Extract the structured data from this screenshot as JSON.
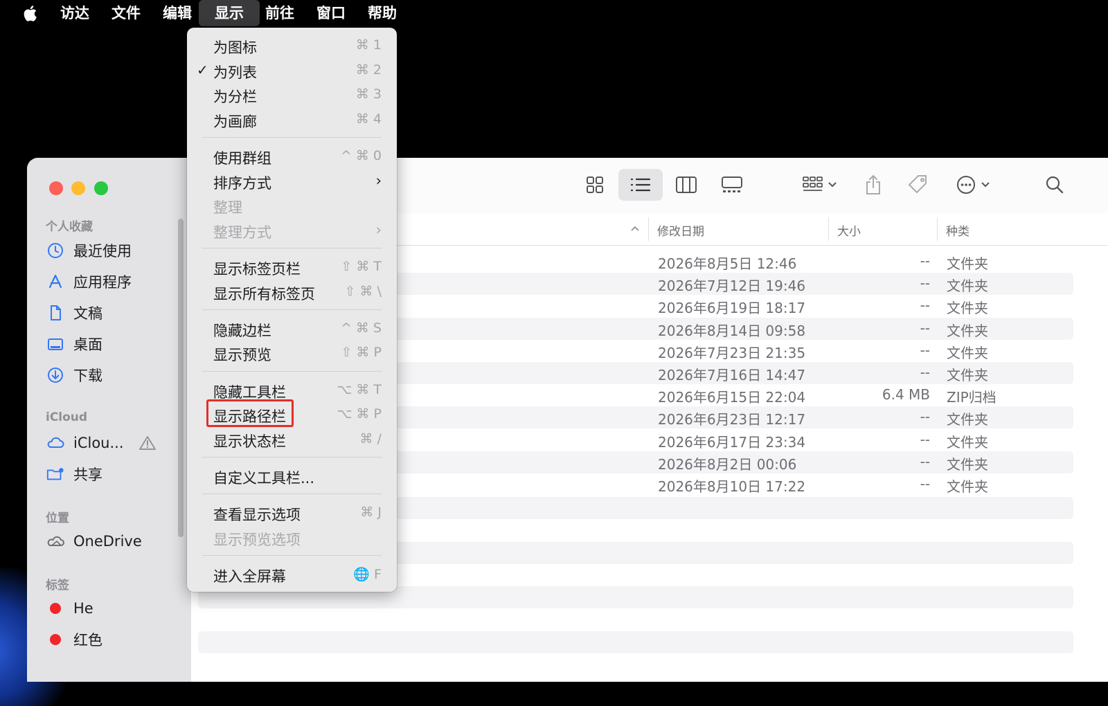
{
  "menubar": {
    "items": [
      "访达",
      "文件",
      "编辑",
      "显示",
      "前往",
      "窗口",
      "帮助"
    ],
    "active": "显示"
  },
  "view_menu": {
    "items": [
      {
        "label": "为图标",
        "shortcut": "⌘ 1",
        "checked": false,
        "disabled": false
      },
      {
        "label": "为列表",
        "shortcut": "⌘ 2",
        "checked": true,
        "disabled": false
      },
      {
        "label": "为分栏",
        "shortcut": "⌘ 3",
        "checked": false,
        "disabled": false
      },
      {
        "label": "为画廊",
        "shortcut": "⌘ 4",
        "checked": false,
        "disabled": false
      },
      {
        "label": "使用群组",
        "shortcut": "^ ⌘ 0",
        "checked": false,
        "disabled": false
      },
      {
        "label": "排序方式",
        "shortcut": "",
        "submenu": true,
        "disabled": false
      },
      {
        "label": "整理",
        "shortcut": "",
        "disabled": true
      },
      {
        "label": "整理方式",
        "shortcut": "",
        "submenu": true,
        "disabled": true
      },
      {
        "label": "显示标签页栏",
        "shortcut": "⇧ ⌘ T",
        "disabled": false
      },
      {
        "label": "显示所有标签页",
        "shortcut": "⇧ ⌘ \\",
        "disabled": false
      },
      {
        "label": "隐藏边栏",
        "shortcut": "^ ⌘ S",
        "disabled": false
      },
      {
        "label": "显示预览",
        "shortcut": "⇧ ⌘ P",
        "disabled": false
      },
      {
        "label": "隐藏工具栏",
        "shortcut": "⌥ ⌘ T",
        "disabled": false
      },
      {
        "label": "显示路径栏",
        "shortcut": "⌥ ⌘ P",
        "disabled": false,
        "highlighted": true
      },
      {
        "label": "显示状态栏",
        "shortcut": "⌘ /",
        "disabled": false
      },
      {
        "label": "自定义工具栏...",
        "shortcut": "",
        "disabled": false
      },
      {
        "label": "查看显示选项",
        "shortcut": "⌘ J",
        "disabled": false
      },
      {
        "label": "显示预览选项",
        "shortcut": "",
        "disabled": true
      },
      {
        "label": "进入全屏幕",
        "shortcut": "🌐 F",
        "disabled": false
      }
    ]
  },
  "sidebar": {
    "favorites_header": "个人收藏",
    "favorites": [
      {
        "label": "最近使用",
        "icon": "clock-icon"
      },
      {
        "label": "应用程序",
        "icon": "applications-icon"
      },
      {
        "label": "文稿",
        "icon": "document-icon"
      },
      {
        "label": "桌面",
        "icon": "desktop-icon"
      },
      {
        "label": "下载",
        "icon": "download-icon"
      }
    ],
    "icloud_header": "iCloud",
    "icloud": [
      {
        "label": "iClou...",
        "icon": "cloud-icon"
      },
      {
        "label": "共享",
        "icon": "shared-folder-icon"
      }
    ],
    "locations_header": "位置",
    "locations": [
      {
        "label": "OneDrive",
        "icon": "onedrive-cloud-icon"
      }
    ],
    "tags_header": "标签",
    "tags": [
      {
        "label": "He",
        "color": "#f0262a"
      },
      {
        "label": "红色",
        "color": "#f0262a"
      }
    ]
  },
  "columns": {
    "date": "修改日期",
    "size": "大小",
    "kind": "种类"
  },
  "files": [
    {
      "date": "2026年8月5日 12:46",
      "size": "--",
      "kind": "文件夹"
    },
    {
      "date": "2026年7月12日 19:46",
      "size": "--",
      "kind": "文件夹"
    },
    {
      "date": "2026年6月19日 18:17",
      "size": "--",
      "kind": "文件夹"
    },
    {
      "date": "2026年8月14日 09:58",
      "size": "--",
      "kind": "文件夹"
    },
    {
      "date": "2026年7月23日 21:35",
      "size": "--",
      "kind": "文件夹"
    },
    {
      "date": "2026年7月16日 14:47",
      "size": "--",
      "kind": "文件夹"
    },
    {
      "date": "2026年6月15日 22:04",
      "size": "6.4 MB",
      "kind": "ZIP归档"
    },
    {
      "date": "2026年6月23日 12:17",
      "size": "--",
      "kind": "文件夹"
    },
    {
      "date": "2026年6月17日 23:34",
      "size": "--",
      "kind": "文件夹"
    },
    {
      "date": "2026年8月2日 00:06",
      "size": "--",
      "kind": "文件夹"
    },
    {
      "date": "2026年8月10日 17:22",
      "size": "--",
      "kind": "文件夹"
    }
  ],
  "colors": {
    "close": "#fe5f57",
    "minimize": "#febc2e",
    "zoom": "#28c840",
    "highlight_box": "#e0302a",
    "sidebar_icon": "#3478f6"
  }
}
